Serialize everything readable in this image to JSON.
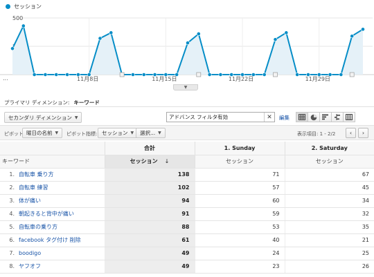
{
  "legend": {
    "label": "セッション",
    "color": "#058dc7"
  },
  "chart_data": {
    "type": "area",
    "ylim": [
      0,
      500
    ],
    "yticks": [
      "500",
      "250"
    ],
    "x_start_label": "...",
    "xtick_labels": [
      "11月8日",
      "11月15日",
      "11月22日",
      "11月29日"
    ],
    "xtick_indices": [
      7,
      14,
      21,
      28
    ],
    "values": [
      230,
      430,
      0,
      0,
      0,
      0,
      0,
      0,
      320,
      370,
      0,
      0,
      0,
      0,
      0,
      0,
      280,
      360,
      0,
      0,
      0,
      0,
      0,
      0,
      310,
      370,
      0,
      0,
      0,
      0,
      0,
      340,
      400
    ],
    "annotation_indices": [
      10,
      17,
      24,
      31
    ],
    "line_color": "#058dc7",
    "fill_color": "#e5f1f8",
    "grid": true
  },
  "primary_dimension": {
    "label": "プライマリ ディメンション:",
    "value": "キーワード"
  },
  "toolbar": {
    "secondary_dimension": "セカンダリ ディメンション",
    "filter_value": "アドバンス フィルタ有効",
    "edit": "編集",
    "views": [
      "table-view-icon",
      "pie-view-icon",
      "performance-view-icon",
      "comparison-view-icon",
      "pivot-view-icon"
    ]
  },
  "pivot": {
    "label": "ピボット:",
    "by": "曜日の名前",
    "metric_label": "ピボット指標:",
    "metric": "セッション",
    "select": "選択...",
    "rows_label": "表示項目:",
    "range": "1 - 2/2",
    "prev": "‹",
    "next": "›"
  },
  "table": {
    "total_header": "合計",
    "col1_header": "1. Sunday",
    "col2_header": "2. Saturday",
    "keyword_header": "キーワード",
    "metric_header": "セッション",
    "sort_arrow": "↓",
    "rows": [
      {
        "idx": "1.",
        "keyword": "自転車 乗り方",
        "total": "138",
        "sun": "71",
        "sat": "67"
      },
      {
        "idx": "2.",
        "keyword": "自転車 練習",
        "total": "102",
        "sun": "57",
        "sat": "45"
      },
      {
        "idx": "3.",
        "keyword": "体が痛い",
        "total": "94",
        "sun": "60",
        "sat": "34"
      },
      {
        "idx": "4.",
        "keyword": "朝起きると背中が痛い",
        "total": "91",
        "sun": "59",
        "sat": "32"
      },
      {
        "idx": "5.",
        "keyword": "自転車の乗り方",
        "total": "88",
        "sun": "53",
        "sat": "35"
      },
      {
        "idx": "6.",
        "keyword": "facebook タグ付け 削除",
        "total": "61",
        "sun": "40",
        "sat": "21"
      },
      {
        "idx": "7.",
        "keyword": "boodigo",
        "total": "49",
        "sun": "24",
        "sat": "25"
      },
      {
        "idx": "8.",
        "keyword": "ヤフオフ",
        "total": "49",
        "sun": "23",
        "sat": "26"
      }
    ]
  }
}
